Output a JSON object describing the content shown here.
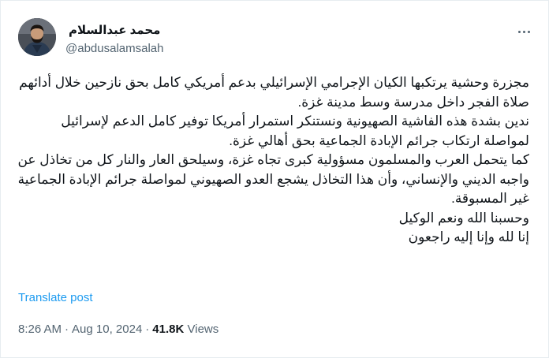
{
  "author": {
    "display_name": "محمد عبدالسلام",
    "handle": "@abdusalamsalah",
    "avatar": "avatar-photo"
  },
  "tweet": {
    "paragraphs": [
      "مجزرة وحشية يرتكبها الكيان الإجرامي الإسرائيلي بدعم أمريكي كامل بحق نازحين خلال أدائهم صلاة الفجر داخل مدرسة وسط مدينة غزة.",
      "ندين بشدة هذه الفاشية الصهيونية ونستنكر استمرار أمريكا توفير كامل الدعم لإسرائيل لمواصلة ارتكاب جرائم الإبادة الجماعية بحق أهالي غزة.",
      "كما يتحمل العرب والمسلمون مسؤولية كبرى تجاه غزة، وسيلحق العار والنار كل من تخاذل عن واجبه الديني والإنساني، وأن هذا التخاذل يشجع العدو الصهيوني لمواصلة جرائم الإبادة الجماعية غير المسبوقة.",
      "وحسبنا الله ونعم الوكيل",
      "إنا لله وإنا إليه راجعون"
    ]
  },
  "translate_label": "Translate post",
  "meta": {
    "time": "8:26 AM",
    "separator": "·",
    "date": "Aug 10, 2024",
    "views_count": "41.8K",
    "views_label": "Views"
  },
  "more_icon": "more-horizontal-icon",
  "colors": {
    "link": "#1d9bf0",
    "secondary_text": "#536471",
    "primary_text": "#0f1419"
  }
}
